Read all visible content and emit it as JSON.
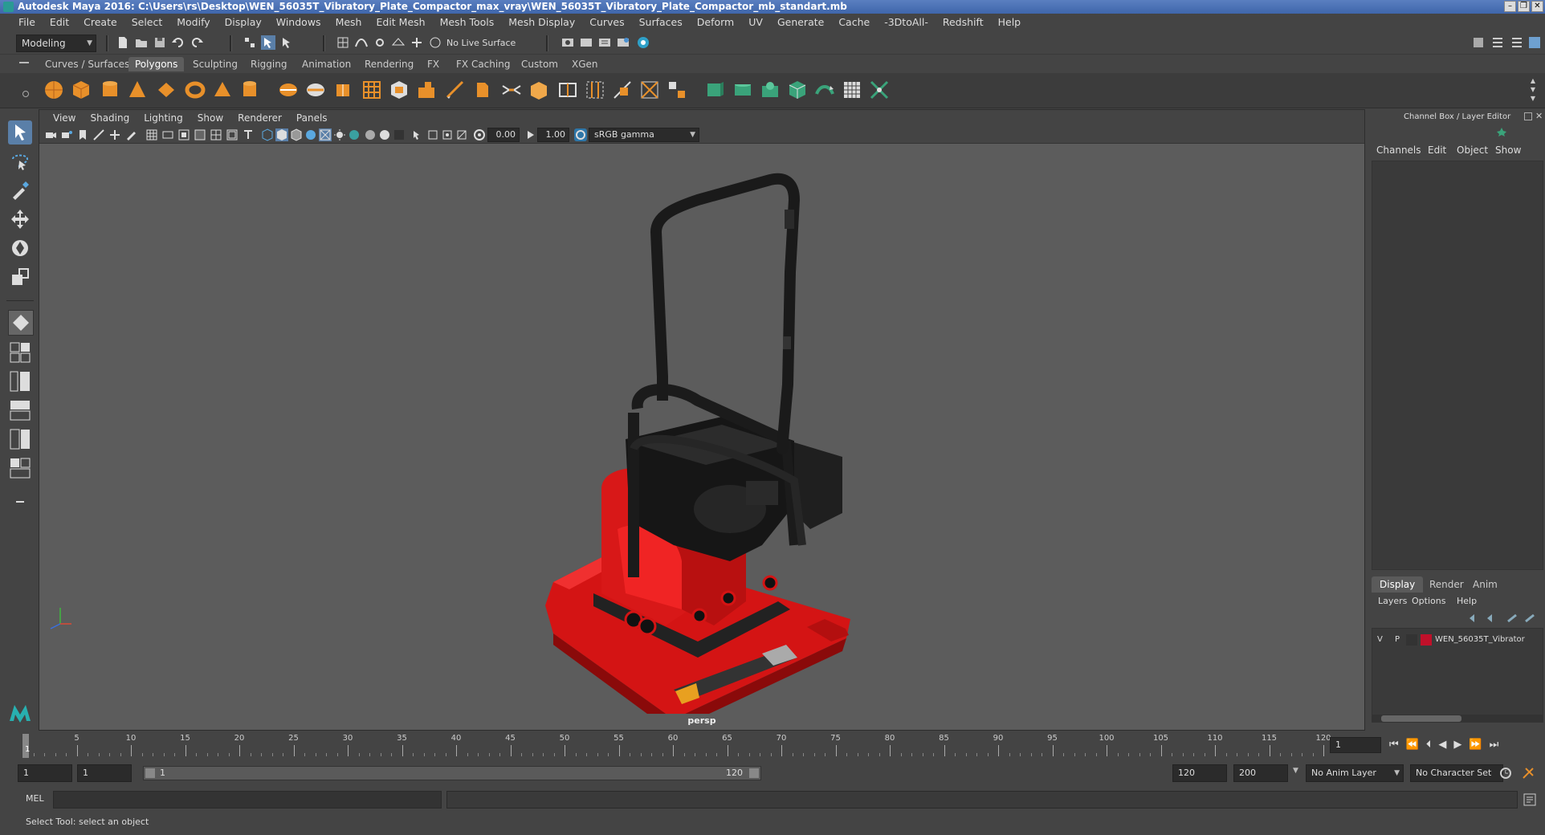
{
  "window": {
    "title": "Autodesk Maya 2016: C:\\Users\\rs\\Desktop\\WEN_56035T_Vibratory_Plate_Compactor_max_vray\\WEN_56035T_Vibratory_Plate_Compactor_mb_standart.mb",
    "controls": [
      "minimize",
      "restore",
      "close"
    ]
  },
  "menubar": [
    "File",
    "Edit",
    "Create",
    "Select",
    "Modify",
    "Display",
    "Windows",
    "Mesh",
    "Edit Mesh",
    "Mesh Tools",
    "Mesh Display",
    "Curves",
    "Surfaces",
    "Deform",
    "UV",
    "Generate",
    "Cache",
    "-3DtoAll-",
    "Redshift",
    "Help"
  ],
  "statusline": {
    "mode_selector": "Modeling",
    "live_surface": "No Live Surface"
  },
  "shelf": {
    "tabs": [
      "Curves / Surfaces",
      "Polygons",
      "Sculpting",
      "Rigging",
      "Animation",
      "Rendering",
      "FX",
      "FX Caching",
      "Custom",
      "XGen"
    ],
    "active_tab": "Polygons"
  },
  "viewport": {
    "menus": [
      "View",
      "Shading",
      "Lighting",
      "Show",
      "Renderer",
      "Panels"
    ],
    "exposure": "0.00",
    "gamma": "1.00",
    "color_space": "sRGB gamma",
    "camera_label": "persp"
  },
  "channel_box": {
    "title": "Channel Box / Layer Editor",
    "menus": [
      "Channels",
      "Edit",
      "Object",
      "Show"
    ],
    "tabs": [
      "Display",
      "Render",
      "Anim"
    ],
    "active_tab": "Display",
    "layer_menus": [
      "Layers",
      "Options",
      "Help"
    ],
    "layer": {
      "visible": "V",
      "playback": "P",
      "name": "WEN_56035T_Vibrator",
      "color": "#c0102a"
    }
  },
  "timeslider": {
    "ticks": [
      "5",
      "10",
      "15",
      "20",
      "25",
      "30",
      "35",
      "40",
      "45",
      "50",
      "55",
      "60",
      "65",
      "70",
      "75",
      "80",
      "85",
      "90",
      "95",
      "100",
      "105",
      "110",
      "115",
      "120"
    ],
    "start_label": "1",
    "current_frame": "1"
  },
  "rangebar": {
    "start": "1",
    "playback_start": "1",
    "range_start_label": "1",
    "range_end_label": "120",
    "playback_end": "120",
    "end": "200",
    "anim_layer": "No Anim Layer",
    "character_set": "No Character Set"
  },
  "cmdline": {
    "language": "MEL"
  },
  "helpline": {
    "text": "Select Tool: select an object"
  }
}
